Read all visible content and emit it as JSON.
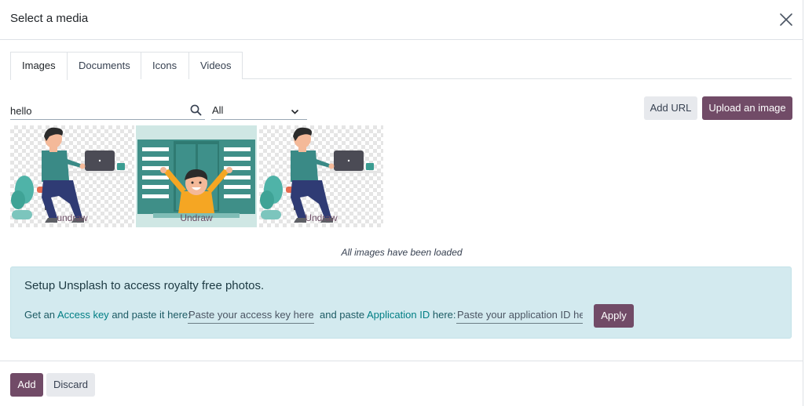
{
  "dialog": {
    "title": "Select a media"
  },
  "tabs": [
    {
      "label": "Images",
      "active": true
    },
    {
      "label": "Documents",
      "active": false
    },
    {
      "label": "Icons",
      "active": false
    },
    {
      "label": "Videos",
      "active": false
    }
  ],
  "search": {
    "value": "hello",
    "placeholder": ""
  },
  "filter": {
    "selected": "All"
  },
  "toolbar": {
    "add_url_label": "Add URL",
    "upload_label": "Upload an image"
  },
  "images": [
    {
      "caption": "undraw",
      "icon": "person-at-laptop-illustration"
    },
    {
      "caption": "Undraw",
      "icon": "person-at-window-illustration"
    },
    {
      "caption": "Undraw",
      "icon": "person-at-laptop-illustration"
    }
  ],
  "status": {
    "loaded_text": "All images have been loaded"
  },
  "unsplash": {
    "title": "Setup Unsplash to access royalty free photos.",
    "get_prefix": "Get an",
    "access_key_link": "Access key",
    "access_suffix": "and paste it here:",
    "access_placeholder": "Paste your access key here",
    "app_prefix": "and paste",
    "app_link": "Application ID",
    "app_suffix": "here:",
    "app_placeholder": "Paste your application ID here",
    "apply_label": "Apply"
  },
  "footer": {
    "add_label": "Add",
    "discard_label": "Discard"
  },
  "colors": {
    "primary": "#714b67",
    "secondary": "#e7e9ed",
    "info_bg": "#d3eaef",
    "link": "#017e84"
  }
}
